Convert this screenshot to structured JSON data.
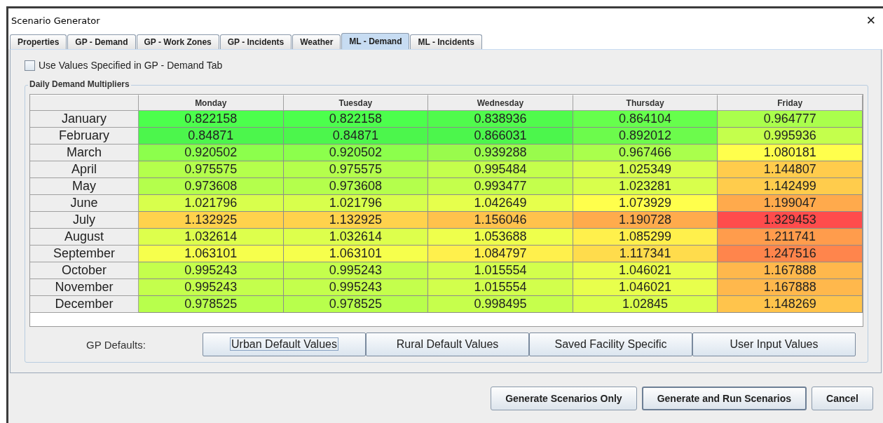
{
  "window": {
    "title": "Scenario Generator",
    "close": "✕"
  },
  "tabs": [
    {
      "label": "Properties",
      "selected": false
    },
    {
      "label": "GP - Demand",
      "selected": false
    },
    {
      "label": "GP - Work Zones",
      "selected": false
    },
    {
      "label": "GP - Incidents",
      "selected": false
    },
    {
      "label": "Weather",
      "selected": false
    },
    {
      "label": "ML - Demand",
      "selected": true
    },
    {
      "label": "ML - Incidents",
      "selected": false
    }
  ],
  "use_gp_values": {
    "label": "Use Values Specified in GP - Demand Tab",
    "checked": false
  },
  "group_title": "Daily Demand Multipliers",
  "table": {
    "columns": [
      "Monday",
      "Tuesday",
      "Wednesday",
      "Thursday",
      "Friday"
    ],
    "rows": [
      {
        "label": "January",
        "cells": [
          {
            "value": "0.822158",
            "color": "#4cff4c"
          },
          {
            "value": "0.822158",
            "color": "#4cff4c"
          },
          {
            "value": "0.838936",
            "color": "#50fb4c"
          },
          {
            "value": "0.864104",
            "color": "#66ff4c"
          },
          {
            "value": "0.964777",
            "color": "#aaff4c"
          }
        ]
      },
      {
        "label": "February",
        "cells": [
          {
            "value": "0.84871",
            "color": "#4cf64c"
          },
          {
            "value": "0.84871",
            "color": "#4cf64c"
          },
          {
            "value": "0.866031",
            "color": "#4cf64c"
          },
          {
            "value": "0.892012",
            "color": "#6cfb4c"
          },
          {
            "value": "0.995936",
            "color": "#c4ff4c"
          }
        ]
      },
      {
        "label": "March",
        "cells": [
          {
            "value": "0.920502",
            "color": "#8cff4c"
          },
          {
            "value": "0.920502",
            "color": "#8cff4c"
          },
          {
            "value": "0.939288",
            "color": "#99fb4c"
          },
          {
            "value": "0.967466",
            "color": "#aaff4c"
          },
          {
            "value": "1.080181",
            "color": "#ffff4c"
          }
        ]
      },
      {
        "label": "April",
        "cells": [
          {
            "value": "0.975575",
            "color": "#b4ff4c"
          },
          {
            "value": "0.975575",
            "color": "#b4ff4c"
          },
          {
            "value": "0.995484",
            "color": "#c4ff4c"
          },
          {
            "value": "1.025349",
            "color": "#d8ff4c"
          },
          {
            "value": "1.144807",
            "color": "#ffcc4c"
          }
        ]
      },
      {
        "label": "May",
        "cells": [
          {
            "value": "0.973608",
            "color": "#b4ff4c"
          },
          {
            "value": "0.973608",
            "color": "#b4ff4c"
          },
          {
            "value": "0.993477",
            "color": "#c4ff4c"
          },
          {
            "value": "1.023281",
            "color": "#d8ff4c"
          },
          {
            "value": "1.142499",
            "color": "#ffcc4c"
          }
        ]
      },
      {
        "label": "June",
        "cells": [
          {
            "value": "1.021796",
            "color": "#d8ff4c"
          },
          {
            "value": "1.021796",
            "color": "#d8ff4c"
          },
          {
            "value": "1.042649",
            "color": "#e6ff4c"
          },
          {
            "value": "1.073929",
            "color": "#ffff4c"
          },
          {
            "value": "1.199047",
            "color": "#ffaa4c"
          }
        ]
      },
      {
        "label": "July",
        "cells": [
          {
            "value": "1.132925",
            "color": "#ffd24c"
          },
          {
            "value": "1.132925",
            "color": "#ffd24c"
          },
          {
            "value": "1.156046",
            "color": "#ffc24c"
          },
          {
            "value": "1.190728",
            "color": "#ffab4c"
          },
          {
            "value": "1.329453",
            "color": "#ff4c4c"
          }
        ]
      },
      {
        "label": "August",
        "cells": [
          {
            "value": "1.032614",
            "color": "#ddff4c"
          },
          {
            "value": "1.032614",
            "color": "#ddff4c"
          },
          {
            "value": "1.053688",
            "color": "#eeff4c"
          },
          {
            "value": "1.085299",
            "color": "#fff04c"
          },
          {
            "value": "1.211741",
            "color": "#ff9c4c"
          }
        ]
      },
      {
        "label": "September",
        "cells": [
          {
            "value": "1.063101",
            "color": "#f6ff4c"
          },
          {
            "value": "1.063101",
            "color": "#f6ff4c"
          },
          {
            "value": "1.084797",
            "color": "#fff04c"
          },
          {
            "value": "1.117341",
            "color": "#ffdc4c"
          },
          {
            "value": "1.247516",
            "color": "#ff854c"
          }
        ]
      },
      {
        "label": "October",
        "cells": [
          {
            "value": "0.995243",
            "color": "#c4ff4c"
          },
          {
            "value": "0.995243",
            "color": "#c4ff4c"
          },
          {
            "value": "1.015554",
            "color": "#d2ff4c"
          },
          {
            "value": "1.046021",
            "color": "#e8ff4c"
          },
          {
            "value": "1.167888",
            "color": "#ffb84c"
          }
        ]
      },
      {
        "label": "November",
        "cells": [
          {
            "value": "0.995243",
            "color": "#c4ff4c"
          },
          {
            "value": "0.995243",
            "color": "#c4ff4c"
          },
          {
            "value": "1.015554",
            "color": "#d2ff4c"
          },
          {
            "value": "1.046021",
            "color": "#e8ff4c"
          },
          {
            "value": "1.167888",
            "color": "#ffb84c"
          }
        ]
      },
      {
        "label": "December",
        "cells": [
          {
            "value": "0.978525",
            "color": "#b8ff4c"
          },
          {
            "value": "0.978525",
            "color": "#b8ff4c"
          },
          {
            "value": "0.998495",
            "color": "#c6ff4c"
          },
          {
            "value": "1.02845",
            "color": "#daff4c"
          },
          {
            "value": "1.148269",
            "color": "#ffc44c"
          }
        ]
      }
    ]
  },
  "gp_defaults": {
    "label": "GP Defaults:",
    "buttons": [
      {
        "label": "Urban Default Values",
        "focused": true
      },
      {
        "label": "Rural Default Values",
        "focused": false
      },
      {
        "label": "Saved Facility Specific",
        "focused": false
      },
      {
        "label": "User Input Values",
        "focused": false
      }
    ]
  },
  "footer_buttons": [
    {
      "label": "Generate Scenarios Only",
      "focused": false
    },
    {
      "label": "Generate and Run Scenarios",
      "focused": true
    },
    {
      "label": "Cancel",
      "focused": false
    }
  ]
}
